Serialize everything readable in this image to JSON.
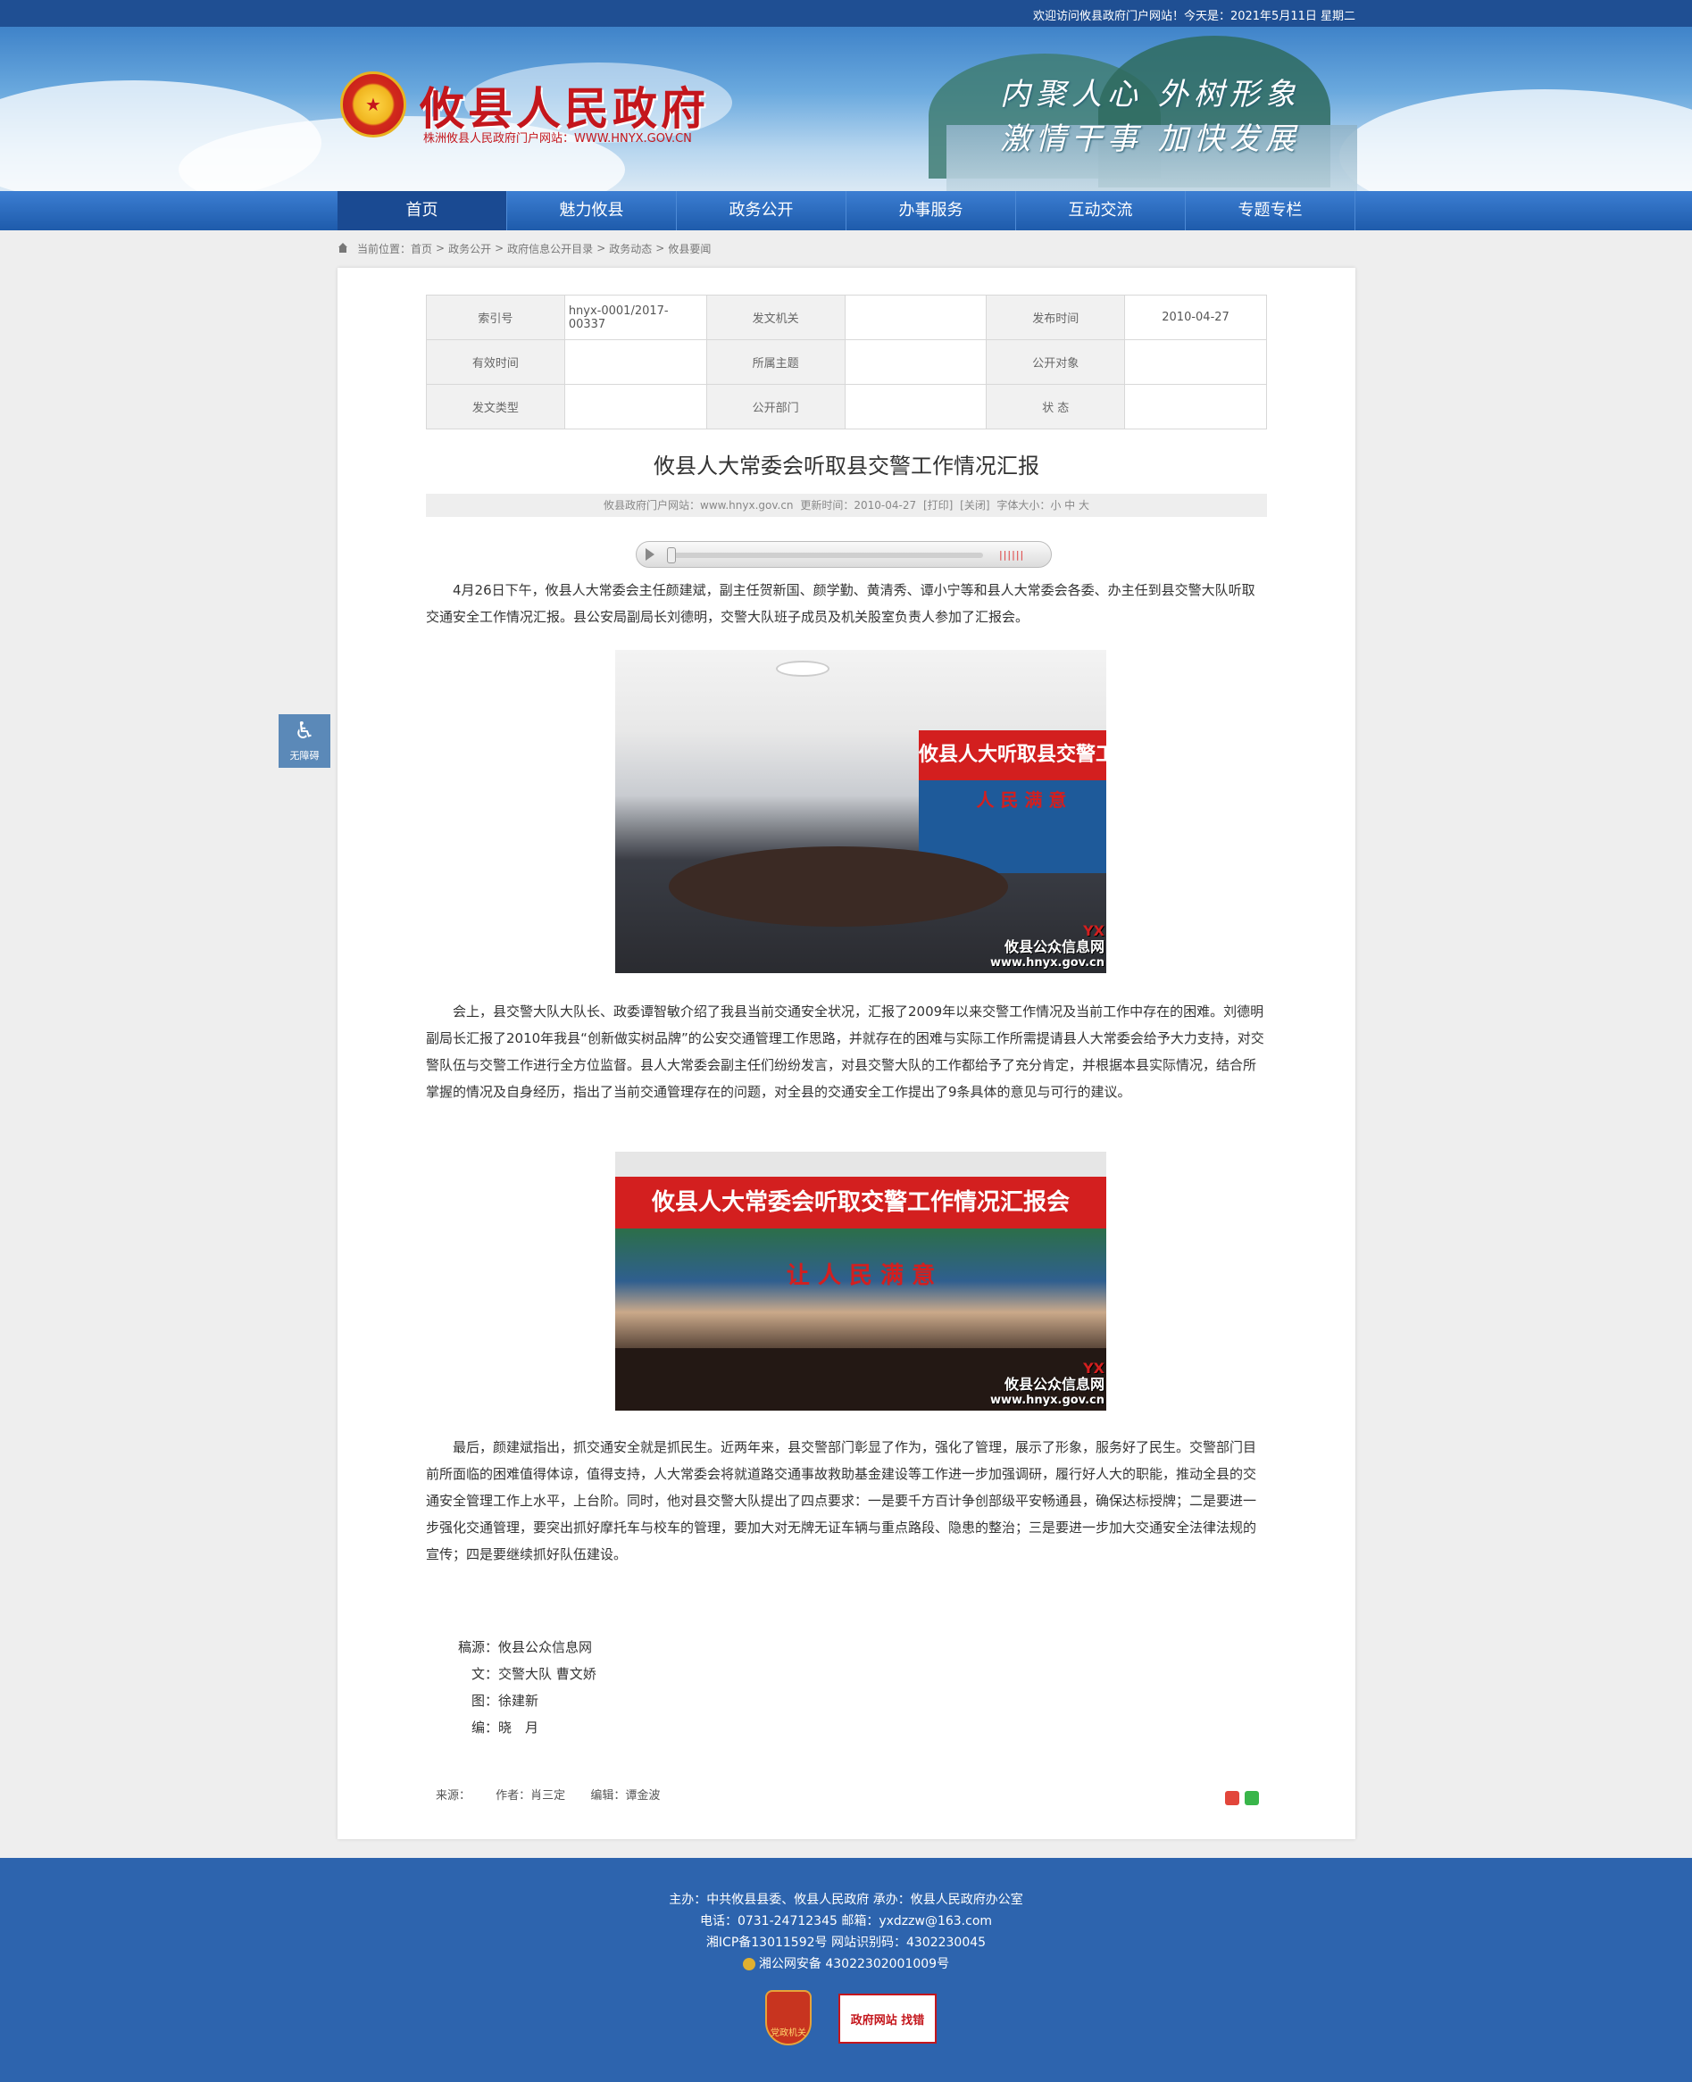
{
  "topbar": {
    "welcome": "欢迎访问攸县政府门户网站！今天是：2021年5月11日 星期二"
  },
  "header": {
    "emblem": "national-emblem-icon",
    "site_title": "攸县人民政府",
    "site_subtitle": "株洲攸县人民政府门户网站：WWW.HNYX.GOV.CN",
    "slogan_line1": "内聚人心  外树形象",
    "slogan_line2": "激情干事  加快发展"
  },
  "nav": {
    "items": [
      {
        "label": "首页"
      },
      {
        "label": "魅力攸县"
      },
      {
        "label": "政务公开"
      },
      {
        "label": "办事服务"
      },
      {
        "label": "互动交流"
      },
      {
        "label": "专题专栏"
      }
    ]
  },
  "breadcrumb": {
    "prefix": "当前位置：",
    "items": [
      "首页",
      "政务公开",
      "政府信息公开目录",
      "政务动态",
      "攸县要闻"
    ]
  },
  "meta_table": {
    "index_no_label": "索引号",
    "index_no": "hnyx-0001/2017-00337",
    "issuer_label": "发文机关",
    "issuer": "",
    "publish_time_label": "发布时间",
    "publish_time": "2010-04-27",
    "valid_time_label": "有效时间",
    "valid_time": "",
    "subject_label": "所属主题",
    "subject": "",
    "audience_label": "公开对象",
    "audience": "",
    "doc_type_label": "发文类型",
    "doc_type": "",
    "department_label": "公开部门",
    "department": "",
    "status_label": "状  态",
    "status": ""
  },
  "article": {
    "title": "攸县人大常委会听取县交警工作情况汇报",
    "source_site": "攸县政府门户网站：www.hnyx.gov.cn",
    "update_time": "更新时间：2010-04-27",
    "print": "[打印]",
    "close": "[关闭]",
    "font_size_label": "字体大小：小 中 大",
    "paragraph1": "4月26日下午，攸县人大常委会主任颜建斌，副主任贺新国、颜学勤、黄清秀、谭小宁等和县人大常委会各委、办主任到县交警大队听取交通安全工作情况汇报。县公安局副局长刘德明，交警大队班子成员及机关股室负责人参加了汇报会。",
    "paragraph2": "会上，县交警大队大队长、政委谭智敏介绍了我县当前交通安全状况，汇报了2009年以来交警工作情况及当前工作中存在的困难。刘德明副局长汇报了2010年我县“创新做实树品牌”的公安交通管理工作思路，并就存在的困难与实际工作所需提请县人大常委会给予大力支持，对交警队伍与交警工作进行全方位监督。县人大常委会副主任们纷纷发言，对县交警大队的工作都给予了充分肯定，并根据本县实际情况，结合所掌握的情况及自身经历，指出了当前交通管理存在的问题，对全县的交通安全工作提出了9条具体的意见与可行的建议。",
    "paragraph3": "最后，颜建斌指出，抓交通安全就是抓民生。近两年来，县交警部门彰显了作为，强化了管理，展示了形象，服务好了民生。交警部门目前所面临的困难值得体谅，值得支持，人大常委会将就道路交通事故救助基金建设等工作进一步加强调研，履行好人大的职能，推动全县的交通安全管理工作上水平，上台阶。同时，他对县交警大队提出了四点要求：一是要千方百计争创部级平安畅通县，确保达标授牌；二是要进一步强化交通管理，要突出抓好摩托车与校车的管理，要加大对无牌无证车辆与重点路段、隐患的整治；三是要进一步加大交通安全法律法规的宣传；四是要继续抓好队伍建设。",
    "photo1_banner": "攸县人大听取县交警工作情况汇",
    "photo1_banner2": "人 民 满 意",
    "photo2_banner": "攸县人大常委会听取交警工作情况汇报会",
    "photo2_banner2": "让 人 民 满 意",
    "watermark_logo": "YX",
    "watermark_name": "攸县公众信息网",
    "watermark_url": "www.hnyx.gov.cn"
  },
  "credits": [
    {
      "label": "稿源：",
      "value": "攸县公众信息网"
    },
    {
      "label": "文：",
      "value": "交警大队 曹文娇"
    },
    {
      "label": "图：",
      "value": "徐建新"
    },
    {
      "label": "编：",
      "value": "晓　月"
    }
  ],
  "article_footer": {
    "source": "来源：",
    "author": "作者：肖三定",
    "editor": "编辑：谭金波"
  },
  "accessibility": {
    "label": "无障碍",
    "icon": "wheelchair-icon"
  },
  "footer": {
    "line1": "主办：中共攸县县委、攸县人民政府 承办：攸县人民政府办公室",
    "line2": "电话：0731-24712345 邮箱：yxdzzw@163.com",
    "line3": "湘ICP备13011592号   网站识别码：4302230045",
    "line4": "湘公网安备 43022302001009号",
    "badge1_label": "党政机关",
    "badge2_label": "政府网站 找错"
  },
  "colors": {
    "brand_red": "#c4161c",
    "nav_blue": "#1e5bab",
    "footer_blue": "#2d64ae"
  }
}
